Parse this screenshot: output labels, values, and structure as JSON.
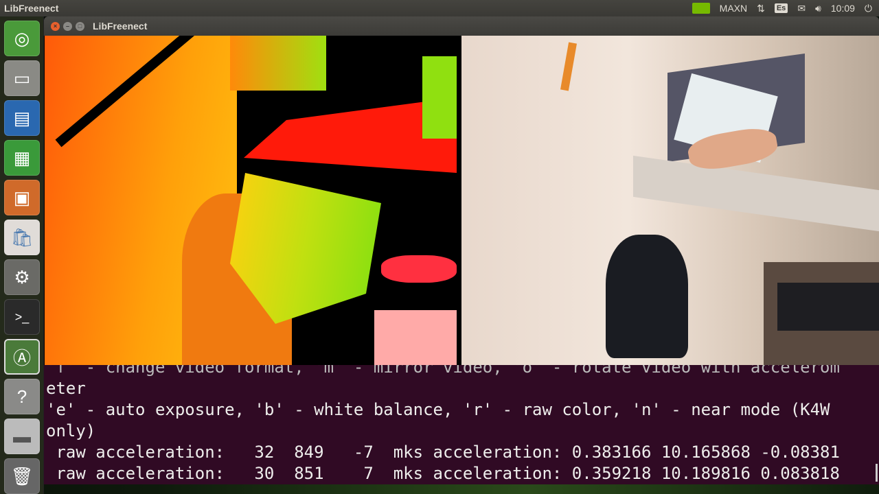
{
  "topbar": {
    "app_title": "LibFreenect",
    "power_mode": "MAXN",
    "keyboard_layout": "Es",
    "time": "10:09"
  },
  "launcher": {
    "items": [
      "Ubuntu Dash",
      "Files",
      "LibreOffice Writer",
      "LibreOffice Calc",
      "LibreOffice Impress",
      "Ubuntu Software",
      "System Settings",
      "Terminal",
      "Software Updater",
      "Help",
      "Drive",
      "Trash"
    ]
  },
  "window": {
    "title": "LibFreenect"
  },
  "terminal": {
    "lines": [
      "'f' - change video format, 'm' - mirror video, 'o' - rotate video with accelerom",
      "eter",
      "'e' - auto exposure, 'b' - white balance, 'r' - raw color, 'n' - near mode (K4W",
      "only)",
      " raw acceleration:   32  849   -7  mks acceleration: 0.383166 10.165868 -0.08381",
      " raw acceleration:   30  851    7  mks acceleration: 0.359218 10.189816 0.083818"
    ]
  }
}
